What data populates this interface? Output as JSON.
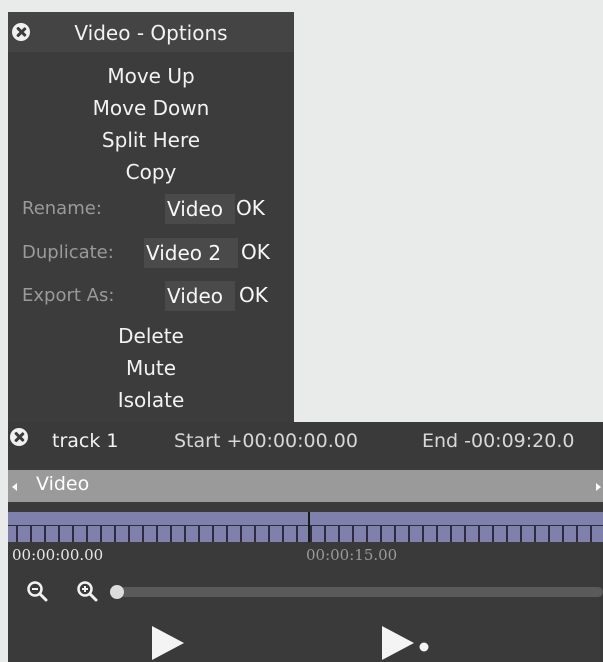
{
  "options_panel": {
    "title": "Video - Options",
    "menu_items": [
      "Move Up",
      "Move Down",
      "Split Here",
      "Copy"
    ],
    "rename": {
      "label": "Rename:",
      "value": "Video",
      "ok": "OK"
    },
    "duplicate": {
      "label": "Duplicate:",
      "value": "Video 2",
      "ok": "OK"
    },
    "export": {
      "label": "Export As:",
      "value": "Video",
      "ok": "OK"
    },
    "bottom_items": [
      "Delete",
      "Mute",
      "Isolate"
    ]
  },
  "track": {
    "name": "track 1",
    "start": "Start +00:00:00.00",
    "end": "End -00:09:20.0",
    "clip_label": "Video",
    "time_left": "00:00:00.00",
    "time_mid": "00:00:15.00"
  },
  "icons": {
    "close": "close-icon",
    "zoom_out": "zoom-out-icon",
    "zoom_in": "zoom-in-icon",
    "play": "play-icon",
    "play_selection": "play-from-cursor-icon"
  },
  "colors": {
    "panel_bg": "#3c3c3c",
    "track_bg": "#3a3a3a",
    "clip_bar": "#9a9a9a",
    "ruler": "#7f80ab",
    "page_bg": "#e9eaea"
  }
}
